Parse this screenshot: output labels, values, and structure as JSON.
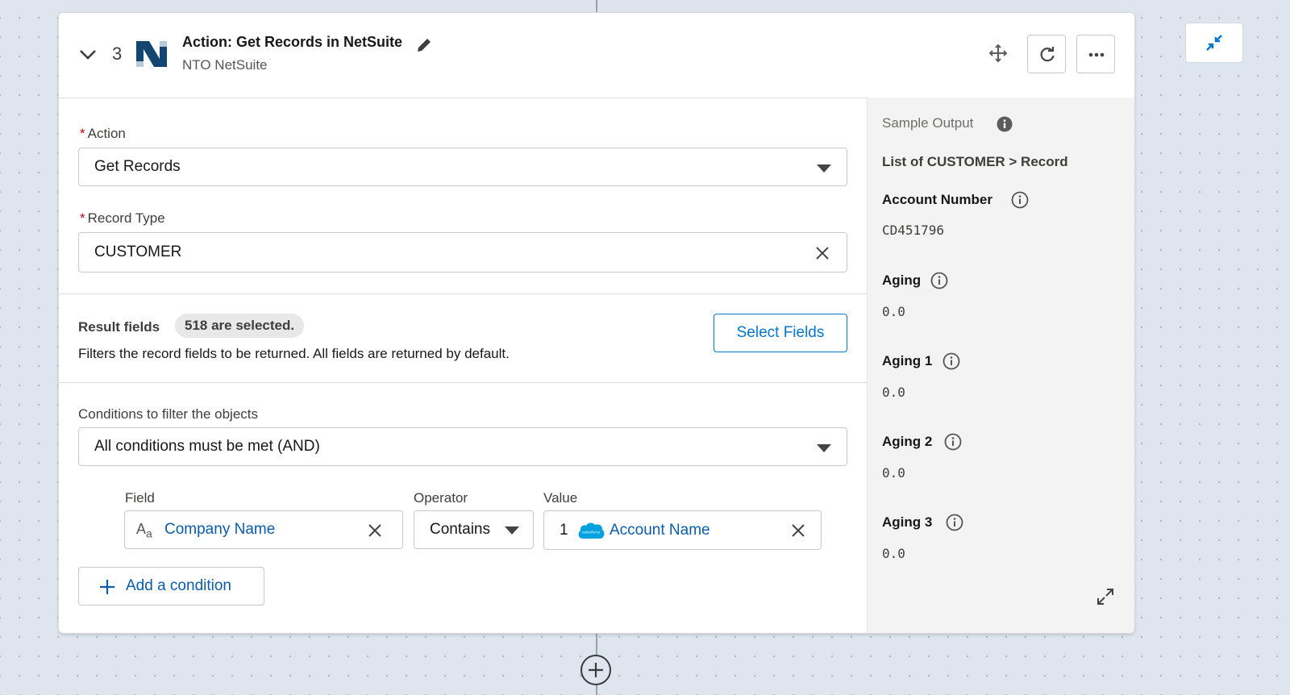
{
  "step": {
    "number": "3",
    "title": "Action: Get Records in NetSuite",
    "subtitle": "NTO NetSuite"
  },
  "form": {
    "action_label": "Action",
    "action_value": "Get Records",
    "record_type_label": "Record Type",
    "record_type_value": "CUSTOMER",
    "result_fields_label": "Result fields",
    "result_fields_badge": "518 are selected.",
    "result_fields_desc": "Filters the record fields to be returned. All fields are returned by default.",
    "select_fields_label": "Select Fields",
    "conditions_label": "Conditions to filter the objects",
    "conditions_value": "All conditions must be met (AND)",
    "condition": {
      "field_header": "Field",
      "operator_header": "Operator",
      "value_header": "Value",
      "field": "Company Name",
      "operator": "Contains",
      "value_prefix": "1",
      "value": "Account Name"
    },
    "add_condition_label": "Add a condition"
  },
  "sample_output": {
    "title": "Sample Output",
    "path": "List of CUSTOMER > Record",
    "fields": [
      {
        "name": "Account Number",
        "value": "CD451796"
      },
      {
        "name": "Aging",
        "value": "0.0"
      },
      {
        "name": "Aging 1",
        "value": "0.0"
      },
      {
        "name": "Aging 2",
        "value": "0.0"
      },
      {
        "name": "Aging 3",
        "value": "0.0"
      }
    ]
  },
  "colors": {
    "brand_blue": "#0176d3",
    "link_blue": "#0b5cab",
    "required_red": "#ba0517",
    "netsuite_navy": "#12456f"
  },
  "icons": [
    "chevron-down-icon",
    "netsuite-logo",
    "pencil-icon",
    "move-icon",
    "refresh-icon",
    "more-icon",
    "collapse-icon",
    "info-icon",
    "text-type-icon",
    "salesforce-cloud-icon",
    "close-icon",
    "plus-icon",
    "expand-icon",
    "add-circle-icon"
  ]
}
